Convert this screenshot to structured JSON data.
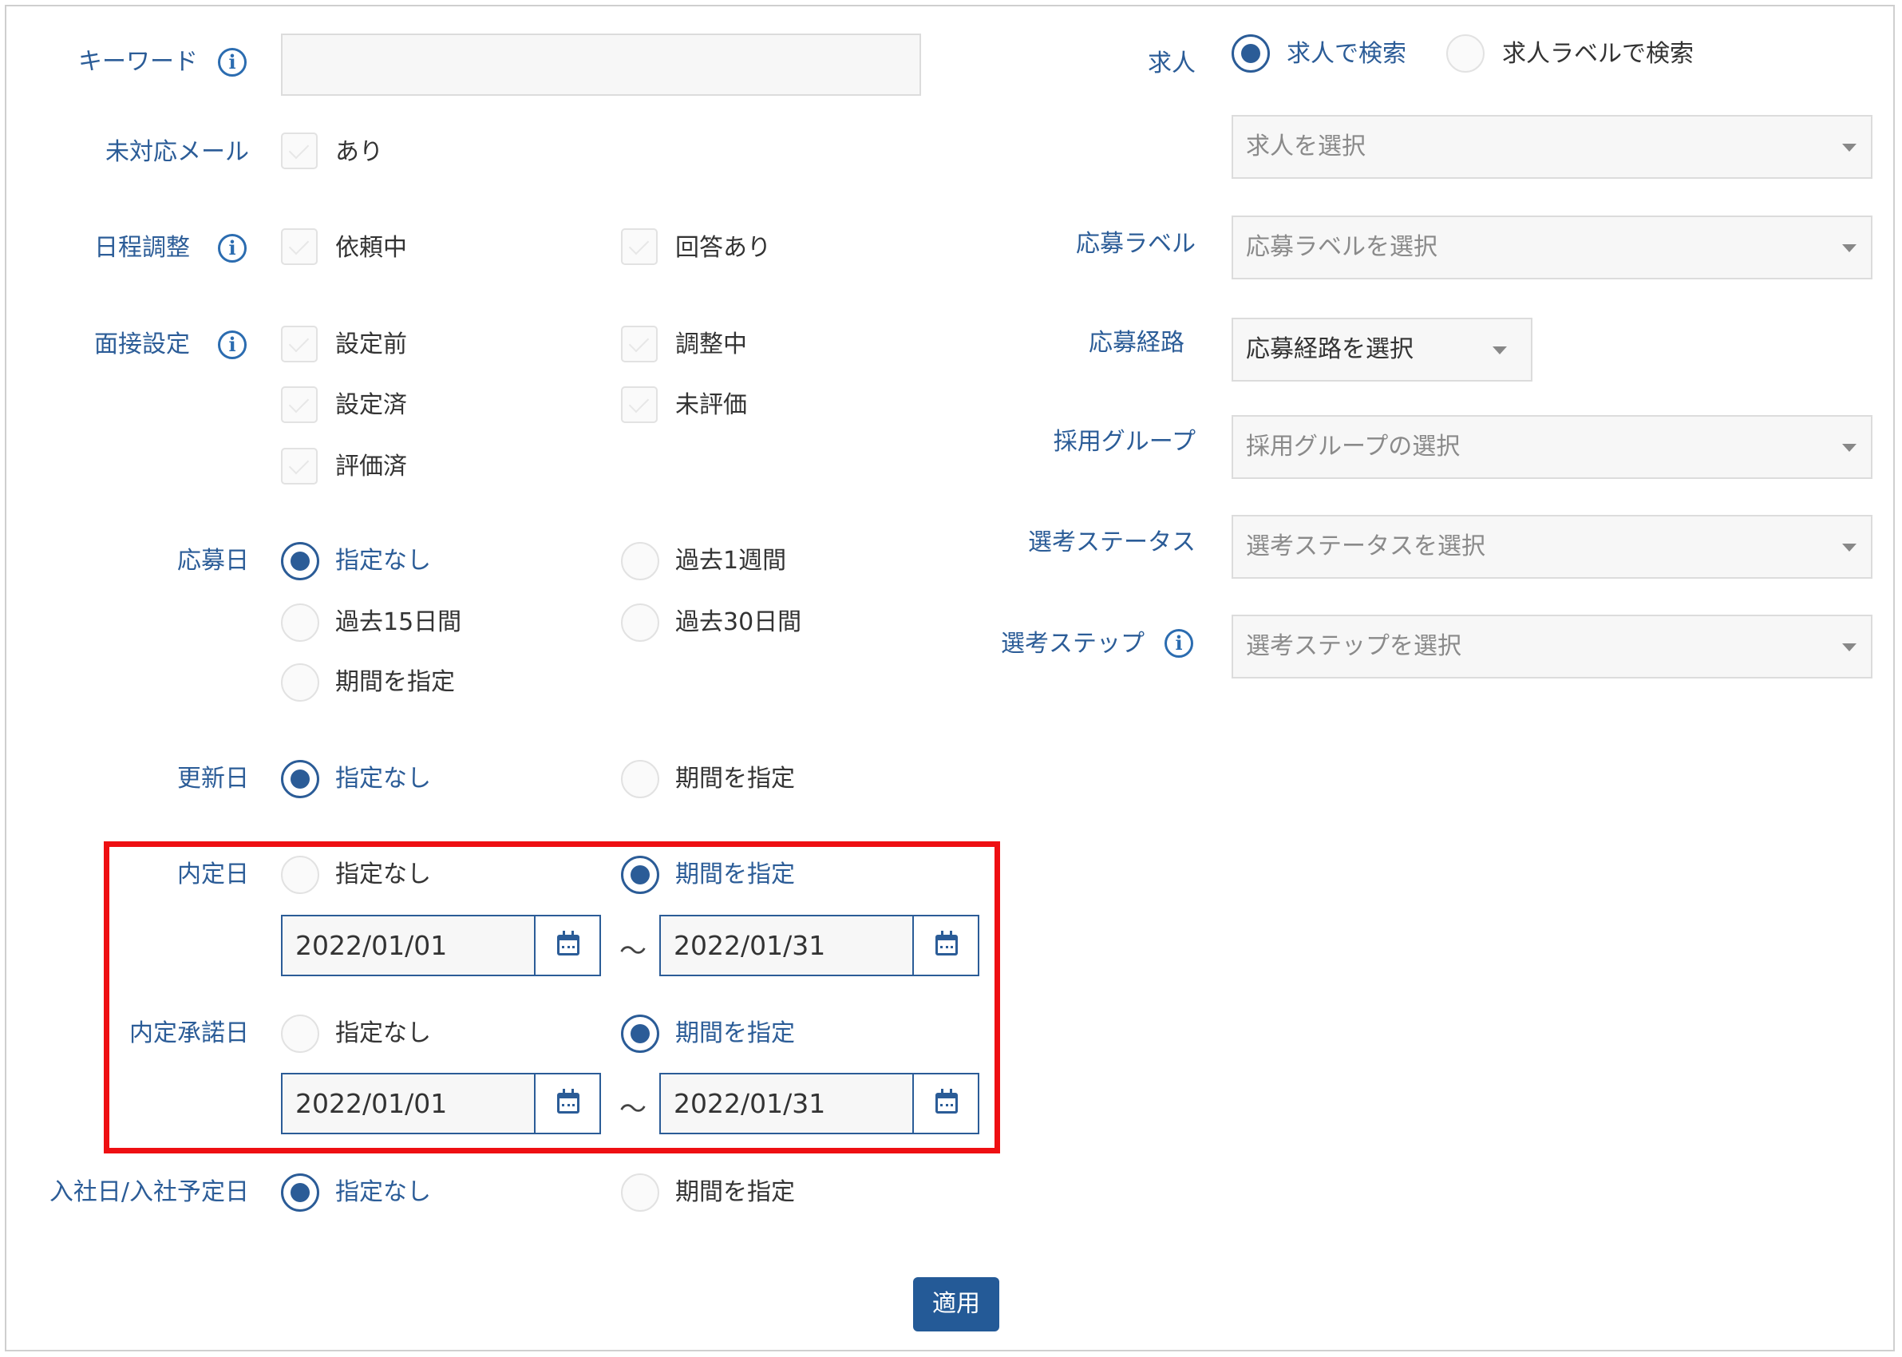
{
  "left": {
    "keyword": {
      "label": "キーワード",
      "value": ""
    },
    "unresponded": {
      "label": "未対応メール",
      "options": [
        "あり"
      ]
    },
    "schedule": {
      "label": "日程調整",
      "options": [
        "依頼中",
        "回答あり"
      ]
    },
    "interview": {
      "label": "面接設定",
      "options": [
        "設定前",
        "調整中",
        "設定済",
        "未評価",
        "評価済"
      ]
    },
    "applied": {
      "label": "応募日",
      "options": [
        "指定なし",
        "過去1週間",
        "過去15日間",
        "過去30日間",
        "期間を指定"
      ],
      "selected": "指定なし"
    },
    "updated": {
      "label": "更新日",
      "options": [
        "指定なし",
        "期間を指定"
      ],
      "selected": "指定なし"
    },
    "offer": {
      "label": "内定日",
      "options": [
        "指定なし",
        "期間を指定"
      ],
      "selected": "期間を指定",
      "from": "2022/01/01",
      "to": "2022/01/31"
    },
    "offer_accept": {
      "label": "内定承諾日",
      "options": [
        "指定なし",
        "期間を指定"
      ],
      "selected": "期間を指定",
      "from": "2022/01/01",
      "to": "2022/01/31"
    },
    "joining": {
      "label": "入社日/入社予定日",
      "options": [
        "指定なし",
        "期間を指定"
      ],
      "selected": "指定なし"
    },
    "range_separator": "～"
  },
  "right": {
    "job": {
      "label": "求人",
      "options": [
        "求人で検索",
        "求人ラベルで検索"
      ],
      "selected": "求人で検索",
      "placeholder": "求人を選択"
    },
    "app_label": {
      "label": "応募ラベル",
      "placeholder": "応募ラベルを選択"
    },
    "source": {
      "label": "応募経路",
      "value": "応募経路を選択"
    },
    "group": {
      "label": "採用グループ",
      "placeholder": "採用グループの選択"
    },
    "status": {
      "label": "選考ステータス",
      "placeholder": "選考ステータスを選択"
    },
    "step": {
      "label": "選考ステップ",
      "placeholder": "選考ステップを選択"
    }
  },
  "apply_label": "適用",
  "colors": {
    "primary": "#2b5c97",
    "highlight": "#ee0f12",
    "button": "#245a97"
  },
  "icons": [
    "info-icon",
    "calendar-icon",
    "chevron-down-icon"
  ]
}
